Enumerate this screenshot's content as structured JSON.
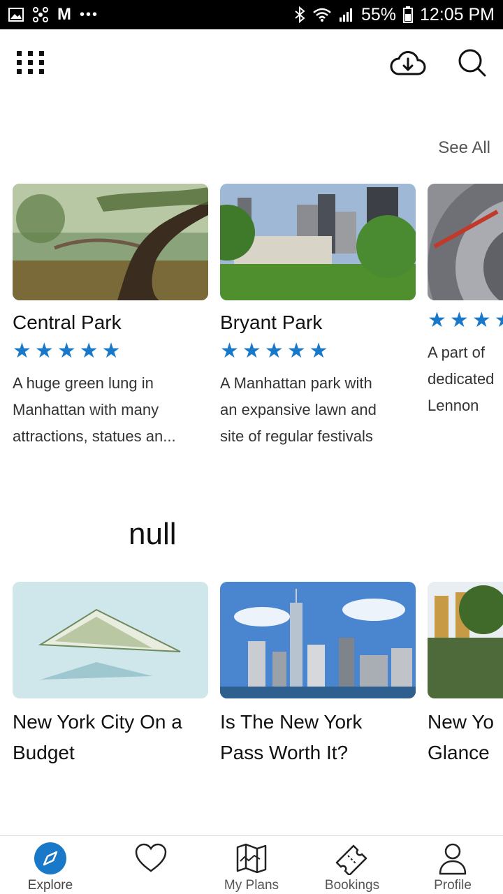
{
  "status_bar": {
    "battery": "55%",
    "time": "12:05 PM",
    "carrier_glyph": "M"
  },
  "section_one": {
    "see_all": "See All",
    "places": [
      {
        "name": "Central Park",
        "rating": 5,
        "desc_lines": [
          "A huge green lung in",
          "Manhattan with many",
          "attractions, statues an..."
        ]
      },
      {
        "name": "Bryant Park",
        "rating": 5,
        "desc_lines": [
          "A Manhattan park with",
          "an expansive lawn and",
          "site of regular festivals"
        ]
      },
      {
        "name": "",
        "rating": 5,
        "desc_lines": [
          "A part of ",
          "dedicated",
          "Lennon"
        ]
      }
    ]
  },
  "section_two": {
    "heading": "null",
    "articles": [
      {
        "title_lines": [
          "New York City On a",
          "Budget"
        ]
      },
      {
        "title_lines": [
          "Is The New York",
          "Pass Worth It?"
        ]
      },
      {
        "title_lines": [
          "New Yo",
          "Glance"
        ]
      }
    ]
  },
  "bottom_nav": {
    "items": [
      {
        "label": "Explore",
        "icon": "compass-icon",
        "active": true
      },
      {
        "label": "",
        "icon": "heart-icon",
        "active": false
      },
      {
        "label": "My Plans",
        "icon": "map-icon",
        "active": false
      },
      {
        "label": "Bookings",
        "icon": "ticket-icon",
        "active": false
      },
      {
        "label": "Profile",
        "icon": "person-icon",
        "active": false
      }
    ]
  },
  "colors": {
    "accent": "#1a78c8",
    "star": "#1a78c8"
  }
}
